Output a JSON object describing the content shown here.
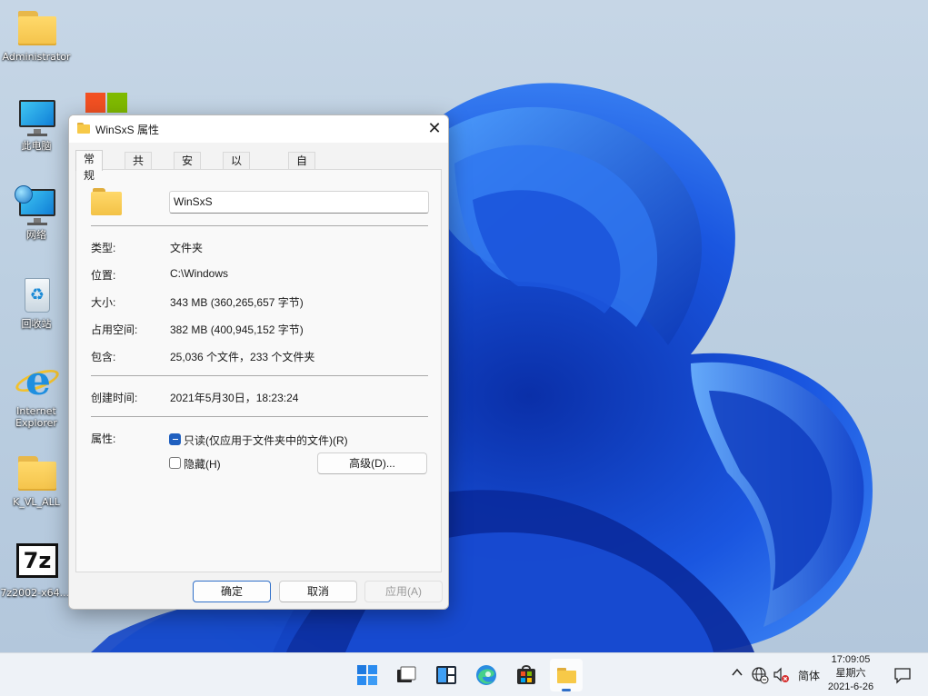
{
  "desktop": {
    "icons": [
      {
        "label": "Administrator",
        "icon": "folder-icon"
      },
      {
        "label": "此电脑",
        "icon": "this-pc-icon"
      },
      {
        "label": "网络",
        "icon": "network-icon"
      },
      {
        "label": "回收站",
        "icon": "recycle-bin-icon"
      },
      {
        "label": "Internet Explorer",
        "icon": "internet-explorer-icon"
      },
      {
        "label": "K_VL_ALL",
        "icon": "folder-icon"
      },
      {
        "label": "7z2002-x64....",
        "icon": "7zip-installer-icon"
      }
    ]
  },
  "window": {
    "title": "WinSxS 属性",
    "tabs": [
      "常规",
      "共享",
      "安全",
      "以前的版本",
      "自定义"
    ],
    "active_tab": "常规",
    "folder_name": "WinSxS",
    "props": {
      "type_label": "类型:",
      "type_value": "文件夹",
      "location_label": "位置:",
      "location_value": "C:\\Windows",
      "size_label": "大小:",
      "size_value": "343 MB (360,265,657 字节)",
      "disk_label": "占用空间:",
      "disk_value": "382 MB (400,945,152 字节)",
      "contains_label": "包含:",
      "contains_value": "25,036 个文件，233 个文件夹",
      "created_label": "创建时间:",
      "created_value": "2021年5月30日，18:23:24",
      "attributes_label": "属性:"
    },
    "attributes": {
      "readonly_label": "只读(仅应用于文件夹中的文件)(R)",
      "readonly_state": "indeterminate",
      "hidden_label": "隐藏(H)",
      "hidden_checked": false,
      "advanced_button": "高级(D)..."
    },
    "buttons": {
      "ok": "确定",
      "cancel": "取消",
      "apply": "应用(A)"
    }
  },
  "taskbar": {
    "apps": [
      "start-icon",
      "task-view-icon",
      "widgets-icon",
      "edge-icon",
      "store-icon",
      "file-explorer-icon"
    ],
    "active_app": "file-explorer-icon",
    "tray": {
      "ime": "简体",
      "time": "17:09:05",
      "weekday": "星期六",
      "date": "2021-6-26"
    }
  },
  "colors": {
    "accent": "#2f6fc9",
    "folder_yellow": "#f7c948",
    "wallpaper_bg": "#bccfe1",
    "bloom_blue": "#1a4fd8"
  }
}
